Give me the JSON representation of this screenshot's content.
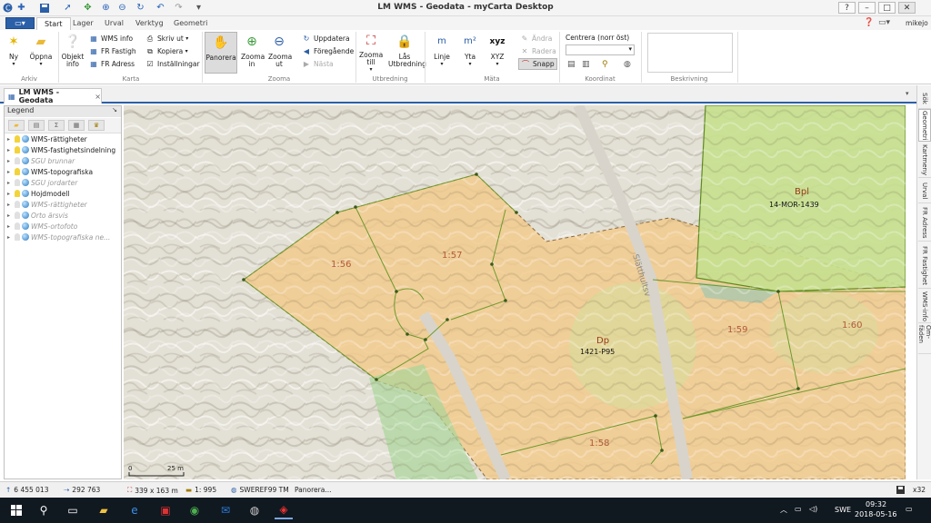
{
  "window": {
    "title": "LM WMS - Geodata - myCarta Desktop",
    "help": "?",
    "minimize": "–",
    "restore": "□",
    "close": "✕",
    "user": "mikejo"
  },
  "ribbon_tabs": [
    "Start",
    "Lager",
    "Urval",
    "Verktyg",
    "Geometri"
  ],
  "ribbon": {
    "arkiv": {
      "label": "Arkiv",
      "ny": "Ny",
      "oppna": "Öppna"
    },
    "karta": {
      "label": "Karta",
      "objekt_info": "Objekt info",
      "wms_info": "WMS info",
      "fr_fastigh": "FR Fastigh",
      "fr_adress": "FR Adress",
      "skriv_ut": "Skriv ut",
      "kopiera": "Kopiera",
      "installningar": "Inställningar"
    },
    "zooma": {
      "label": "Zooma",
      "panorera": "Panorera",
      "zooma_in": "Zooma in",
      "zooma_ut": "Zooma ut",
      "uppdatera": "Uppdatera",
      "foregaende": "Föregående",
      "nasta": "Nästa"
    },
    "utbredning": {
      "label": "Utbredning",
      "zooma_till": "Zooma till",
      "las_utbredning": "Lås Utbredning"
    },
    "mata": {
      "label": "Mäta",
      "linje": "Linje",
      "yta": "Yta",
      "xyz": "XYZ",
      "andra": "Ändra",
      "radera": "Radera",
      "snapp": "Snapp"
    },
    "koordinat": {
      "label": "Koordinat",
      "centrera": "Centrera (norr öst)"
    },
    "beskrivning": {
      "label": "Beskrivning"
    }
  },
  "doc_tab": {
    "label": "LM WMS - Geodata",
    "close": "×"
  },
  "legend": {
    "title": "Legend",
    "pin": "↘",
    "layers": [
      {
        "name": "WMS-rättigheter",
        "dim": false
      },
      {
        "name": "WMS-fastighetsindelning",
        "dim": false
      },
      {
        "name": "SGU brunnar",
        "dim": true
      },
      {
        "name": "WMS-topografiska",
        "dim": false
      },
      {
        "name": "SGU jordarter",
        "dim": true
      },
      {
        "name": "Hojdmodell",
        "dim": false
      },
      {
        "name": "WMS-rättigheter",
        "dim": true
      },
      {
        "name": "Orto ärsvis",
        "dim": true
      },
      {
        "name": "WMS-ortofoto",
        "dim": true
      },
      {
        "name": "WMS-topografiska ne...",
        "dim": true
      }
    ]
  },
  "map": {
    "parcels": [
      {
        "label": "1:56"
      },
      {
        "label": "1:57"
      },
      {
        "label": "1:59"
      },
      {
        "label": "1:60"
      },
      {
        "label": "1:58"
      }
    ],
    "zones": [
      {
        "code": "Dp",
        "id": "1421-P95"
      },
      {
        "code": "Bpl",
        "id": "14-MOR-1439"
      }
    ],
    "road_name": "Slätthultsv",
    "scalebar": {
      "start": "0",
      "end": "25 m"
    }
  },
  "side_tabs": [
    "Sök",
    "Geometri",
    "Kartmeny",
    "Urval",
    "FR Adress",
    "FR Fastighet",
    "WMS-info",
    "Om-fäden"
  ],
  "status": {
    "north": "6 455 013",
    "east": "292 763",
    "size": "339 x 163 m",
    "scale": "1: 995",
    "crs": "SWEREF99 TM",
    "mode": "Panorera...",
    "zoom": "x32"
  },
  "taskbar": {
    "lang": "SWE",
    "time": "09:32",
    "date": "2018-05-16"
  },
  "colors": {
    "accent": "#2b5fa8",
    "parcel_fill": "#f3c98a",
    "zone_green": "#bfe08a",
    "parcel_line": "#6e9a2e"
  }
}
